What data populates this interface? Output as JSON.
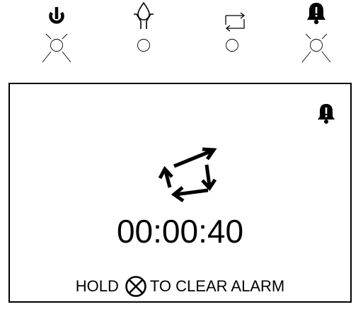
{
  "indicators": [
    {
      "id": "power",
      "icon": "power-icon",
      "lamp": "on"
    },
    {
      "id": "water",
      "icon": "water-drop-icon",
      "lamp": "off"
    },
    {
      "id": "cycle",
      "icon": "cycle-icon",
      "lamp": "off"
    },
    {
      "id": "alarm",
      "icon": "bell-icon",
      "lamp": "on"
    }
  ],
  "display": {
    "alarm_icon": "bell-icon",
    "status_icon": "cycle-icon",
    "timer": "00:00:40",
    "hint_prefix": "HOLD",
    "hint_key_icon": "circle-x-icon",
    "hint_suffix": "TO CLEAR ALARM"
  }
}
